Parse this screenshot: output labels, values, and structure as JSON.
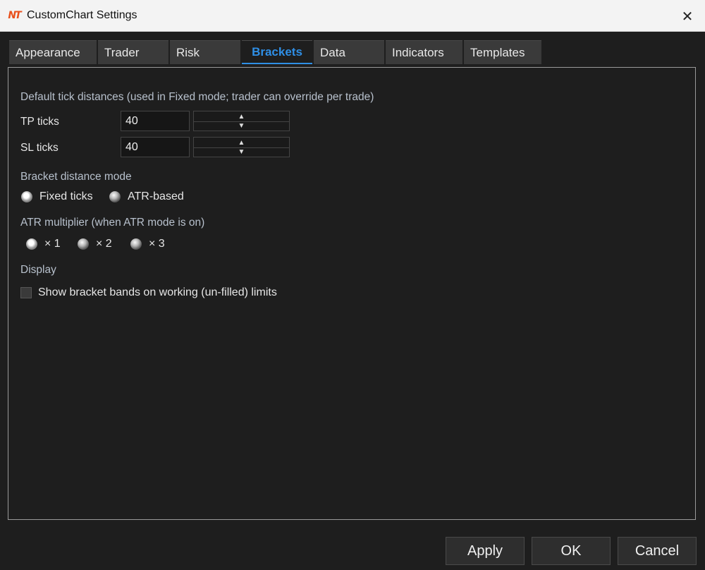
{
  "window": {
    "title": "CustomChart Settings",
    "logo_text": "NT"
  },
  "tabs": [
    {
      "label": "Appearance",
      "active": false
    },
    {
      "label": "Trader",
      "active": false
    },
    {
      "label": "Risk",
      "active": false
    },
    {
      "label": "Brackets",
      "active": true
    },
    {
      "label": "Data",
      "active": false
    },
    {
      "label": "Indicators",
      "active": false
    },
    {
      "label": "Templates",
      "active": false
    }
  ],
  "brackets": {
    "tick_heading": "Default tick distances (used in Fixed mode; trader can override per trade)",
    "tp_label": "TP ticks",
    "tp_value": "40",
    "sl_label": "SL ticks",
    "sl_value": "40",
    "mode_heading": "Bracket distance mode",
    "mode_options": [
      {
        "label": "Fixed ticks",
        "selected": true
      },
      {
        "label": "ATR-based",
        "selected": false
      }
    ],
    "atr_heading": "ATR multiplier (when ATR mode is on)",
    "atr_options": [
      {
        "label": "× 1",
        "selected": true
      },
      {
        "label": "× 2",
        "selected": false
      },
      {
        "label": "× 3",
        "selected": false
      }
    ],
    "display_heading": "Display",
    "show_bands_label": "Show bracket bands on working (un-filled) limits",
    "show_bands_checked": false
  },
  "footer": {
    "apply": "Apply",
    "ok": "OK",
    "cancel": "Cancel"
  },
  "colors": {
    "accent": "#2f8fe6",
    "logo": "#e8501c",
    "background": "#1e1e1e"
  }
}
